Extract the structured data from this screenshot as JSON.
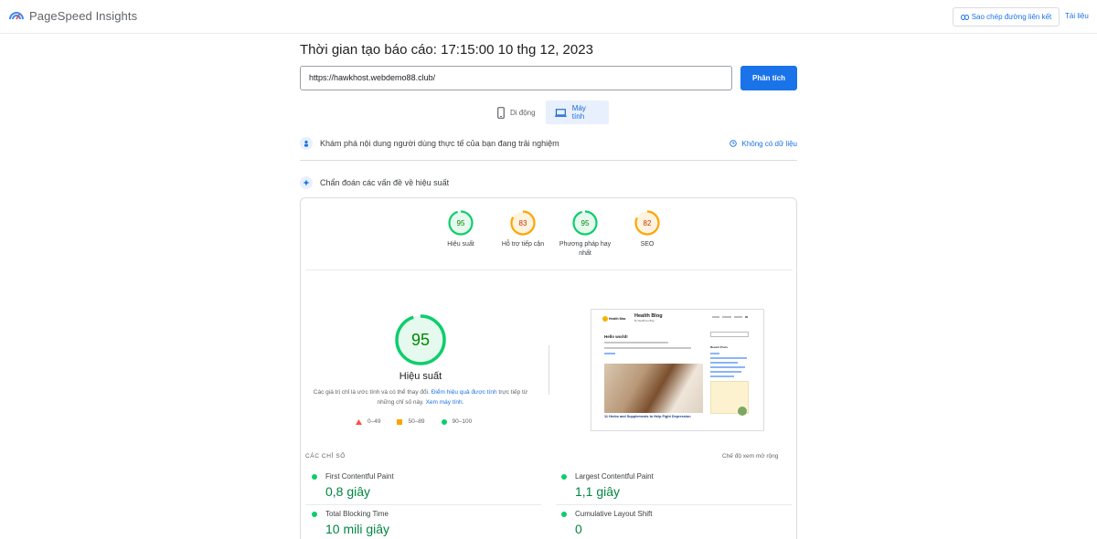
{
  "header": {
    "app_title": "PageSpeed Insights",
    "copy_link_label": "Sao chép đường liên kết",
    "docs_label": "Tài liệu"
  },
  "report": {
    "time_label": "Thời gian tạo báo cáo: 17:15:00 10 thg 12, 2023",
    "url": "https://hawkhost.webdemo88.club/",
    "analyze_label": "Phân tích"
  },
  "device_tabs": [
    {
      "label": "Di động",
      "icon": "phone-icon",
      "active": false
    },
    {
      "label": "Máy tính",
      "icon": "laptop-icon",
      "active": true
    }
  ],
  "sections": {
    "field_data_title": "Khám phá nội dung người dùng thực tế của bạn đang trải nghiệm",
    "no_data_label": "Không có dữ liệu",
    "diagnose_title": "Chẩn đoán các vấn đề về hiệu suất"
  },
  "categories": [
    {
      "score": "95",
      "label": "Hiệu suất",
      "color": "#0cce6b",
      "value": 95
    },
    {
      "score": "83",
      "label": "Hỗ trợ tiếp cận",
      "color": "#ffa400",
      "value": 83
    },
    {
      "score": "95",
      "label": "Phương pháp hay nhất",
      "color": "#0cce6b",
      "value": 95
    },
    {
      "score": "82",
      "label": "SEO",
      "color": "#ffa400",
      "value": 82
    }
  ],
  "performance": {
    "score": "95",
    "score_value": 95,
    "title": "Hiệu suất",
    "disclaimer_pre": "Các giá trị chỉ là ước tính và có thể thay đổi.",
    "disclaimer_link1": "Điểm hiệu quả được tính",
    "disclaimer_mid": "trực tiếp từ những chỉ số này.",
    "disclaimer_link2": "Xem máy tính.",
    "legend": [
      {
        "range": "0–49",
        "color": "#ff4e42",
        "shape": "triangle"
      },
      {
        "range": "50–89",
        "color": "#ffa400",
        "shape": "square"
      },
      {
        "range": "90–100",
        "color": "#0cce6b",
        "shape": "circle"
      }
    ]
  },
  "thumbnail": {
    "logo_text": "Health Max",
    "site_title": "Health Blog",
    "site_subtitle": "By WordPress Blog",
    "post_title": "Hello world!",
    "post_heading": "11 Herbs and Supplements to Help Fight Depression",
    "sidebar_title": "Recent Posts"
  },
  "metrics": {
    "section_label": "CÁC CHỈ SỐ",
    "expand_label": "Chế độ xem mở rộng",
    "items": [
      {
        "name": "First Contentful Paint",
        "value": "0,8 giây",
        "status_color": "#0cce6b"
      },
      {
        "name": "Largest Contentful Paint",
        "value": "1,1 giây",
        "status_color": "#0cce6b"
      },
      {
        "name": "Total Blocking Time",
        "value": "10 mili giây",
        "status_color": "#0cce6b"
      },
      {
        "name": "Cumulative Layout Shift",
        "value": "0",
        "status_color": "#0cce6b"
      }
    ]
  }
}
